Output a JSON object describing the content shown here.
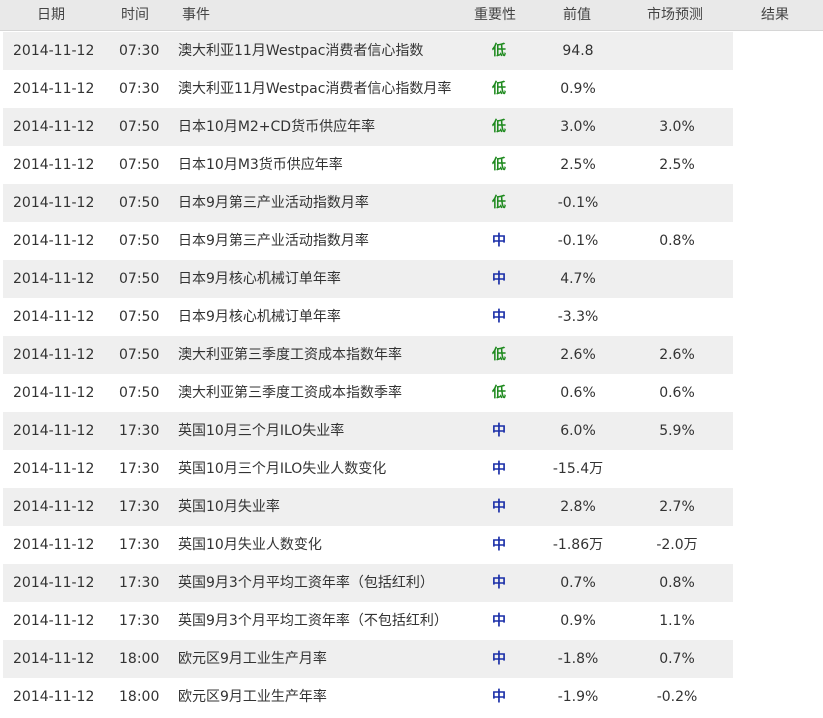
{
  "columns": {
    "date": "日期",
    "time": "时间",
    "event": "事件",
    "importance": "重要性",
    "previous": "前值",
    "forecast": "市场预测",
    "actual": "结果"
  },
  "rows": [
    {
      "date": "2014-11-12",
      "time": "07:30",
      "event": "澳大利亚11月Westpac消费者信心指数",
      "importance": "低",
      "previous": "94.8",
      "forecast": "",
      "actual": ""
    },
    {
      "date": "2014-11-12",
      "time": "07:30",
      "event": "澳大利亚11月Westpac消费者信心指数月率",
      "importance": "低",
      "previous": "0.9%",
      "forecast": "",
      "actual": ""
    },
    {
      "date": "2014-11-12",
      "time": "07:50",
      "event": "日本10月M2+CD货币供应年率",
      "importance": "低",
      "previous": "3.0%",
      "forecast": "3.0%",
      "actual": ""
    },
    {
      "date": "2014-11-12",
      "time": "07:50",
      "event": "日本10月M3货币供应年率",
      "importance": "低",
      "previous": "2.5%",
      "forecast": "2.5%",
      "actual": ""
    },
    {
      "date": "2014-11-12",
      "time": "07:50",
      "event": "日本9月第三产业活动指数月率",
      "importance": "低",
      "previous": "-0.1%",
      "forecast": "",
      "actual": ""
    },
    {
      "date": "2014-11-12",
      "time": "07:50",
      "event": "日本9月第三产业活动指数月率",
      "importance": "中",
      "previous": "-0.1%",
      "forecast": "0.8%",
      "actual": ""
    },
    {
      "date": "2014-11-12",
      "time": "07:50",
      "event": "日本9月核心机械订单年率",
      "importance": "中",
      "previous": "4.7%",
      "forecast": "",
      "actual": ""
    },
    {
      "date": "2014-11-12",
      "time": "07:50",
      "event": "日本9月核心机械订单年率",
      "importance": "中",
      "previous": "-3.3%",
      "forecast": "",
      "actual": ""
    },
    {
      "date": "2014-11-12",
      "time": "07:50",
      "event": "澳大利亚第三季度工资成本指数年率",
      "importance": "低",
      "previous": "2.6%",
      "forecast": "2.6%",
      "actual": ""
    },
    {
      "date": "2014-11-12",
      "time": "07:50",
      "event": "澳大利亚第三季度工资成本指数季率",
      "importance": "低",
      "previous": "0.6%",
      "forecast": "0.6%",
      "actual": ""
    },
    {
      "date": "2014-11-12",
      "time": "17:30",
      "event": "英国10月三个月ILO失业率",
      "importance": "中",
      "previous": "6.0%",
      "forecast": "5.9%",
      "actual": ""
    },
    {
      "date": "2014-11-12",
      "time": "17:30",
      "event": "英国10月三个月ILO失业人数变化",
      "importance": "中",
      "previous": "-15.4万",
      "forecast": "",
      "actual": ""
    },
    {
      "date": "2014-11-12",
      "time": "17:30",
      "event": "英国10月失业率",
      "importance": "中",
      "previous": "2.8%",
      "forecast": "2.7%",
      "actual": ""
    },
    {
      "date": "2014-11-12",
      "time": "17:30",
      "event": "英国10月失业人数变化",
      "importance": "中",
      "previous": "-1.86万",
      "forecast": "-2.0万",
      "actual": ""
    },
    {
      "date": "2014-11-12",
      "time": "17:30",
      "event": "英国9月3个月平均工资年率（包括红利）",
      "importance": "中",
      "previous": "0.7%",
      "forecast": "0.8%",
      "actual": ""
    },
    {
      "date": "2014-11-12",
      "time": "17:30",
      "event": "英国9月3个月平均工资年率（不包括红利）",
      "importance": "中",
      "previous": "0.9%",
      "forecast": "1.1%",
      "actual": ""
    },
    {
      "date": "2014-11-12",
      "time": "18:00",
      "event": "欧元区9月工业生产月率",
      "importance": "中",
      "previous": "-1.8%",
      "forecast": "0.7%",
      "actual": ""
    },
    {
      "date": "2014-11-12",
      "time": "18:00",
      "event": "欧元区9月工业生产年率",
      "importance": "中",
      "previous": "-1.9%",
      "forecast": "-0.2%",
      "actual": ""
    }
  ],
  "colors": {
    "low": "#1f8a1f",
    "mid": "#1a2ea8",
    "header_bg": "#e9e9e9",
    "row_alt_bg": "#efefef"
  }
}
